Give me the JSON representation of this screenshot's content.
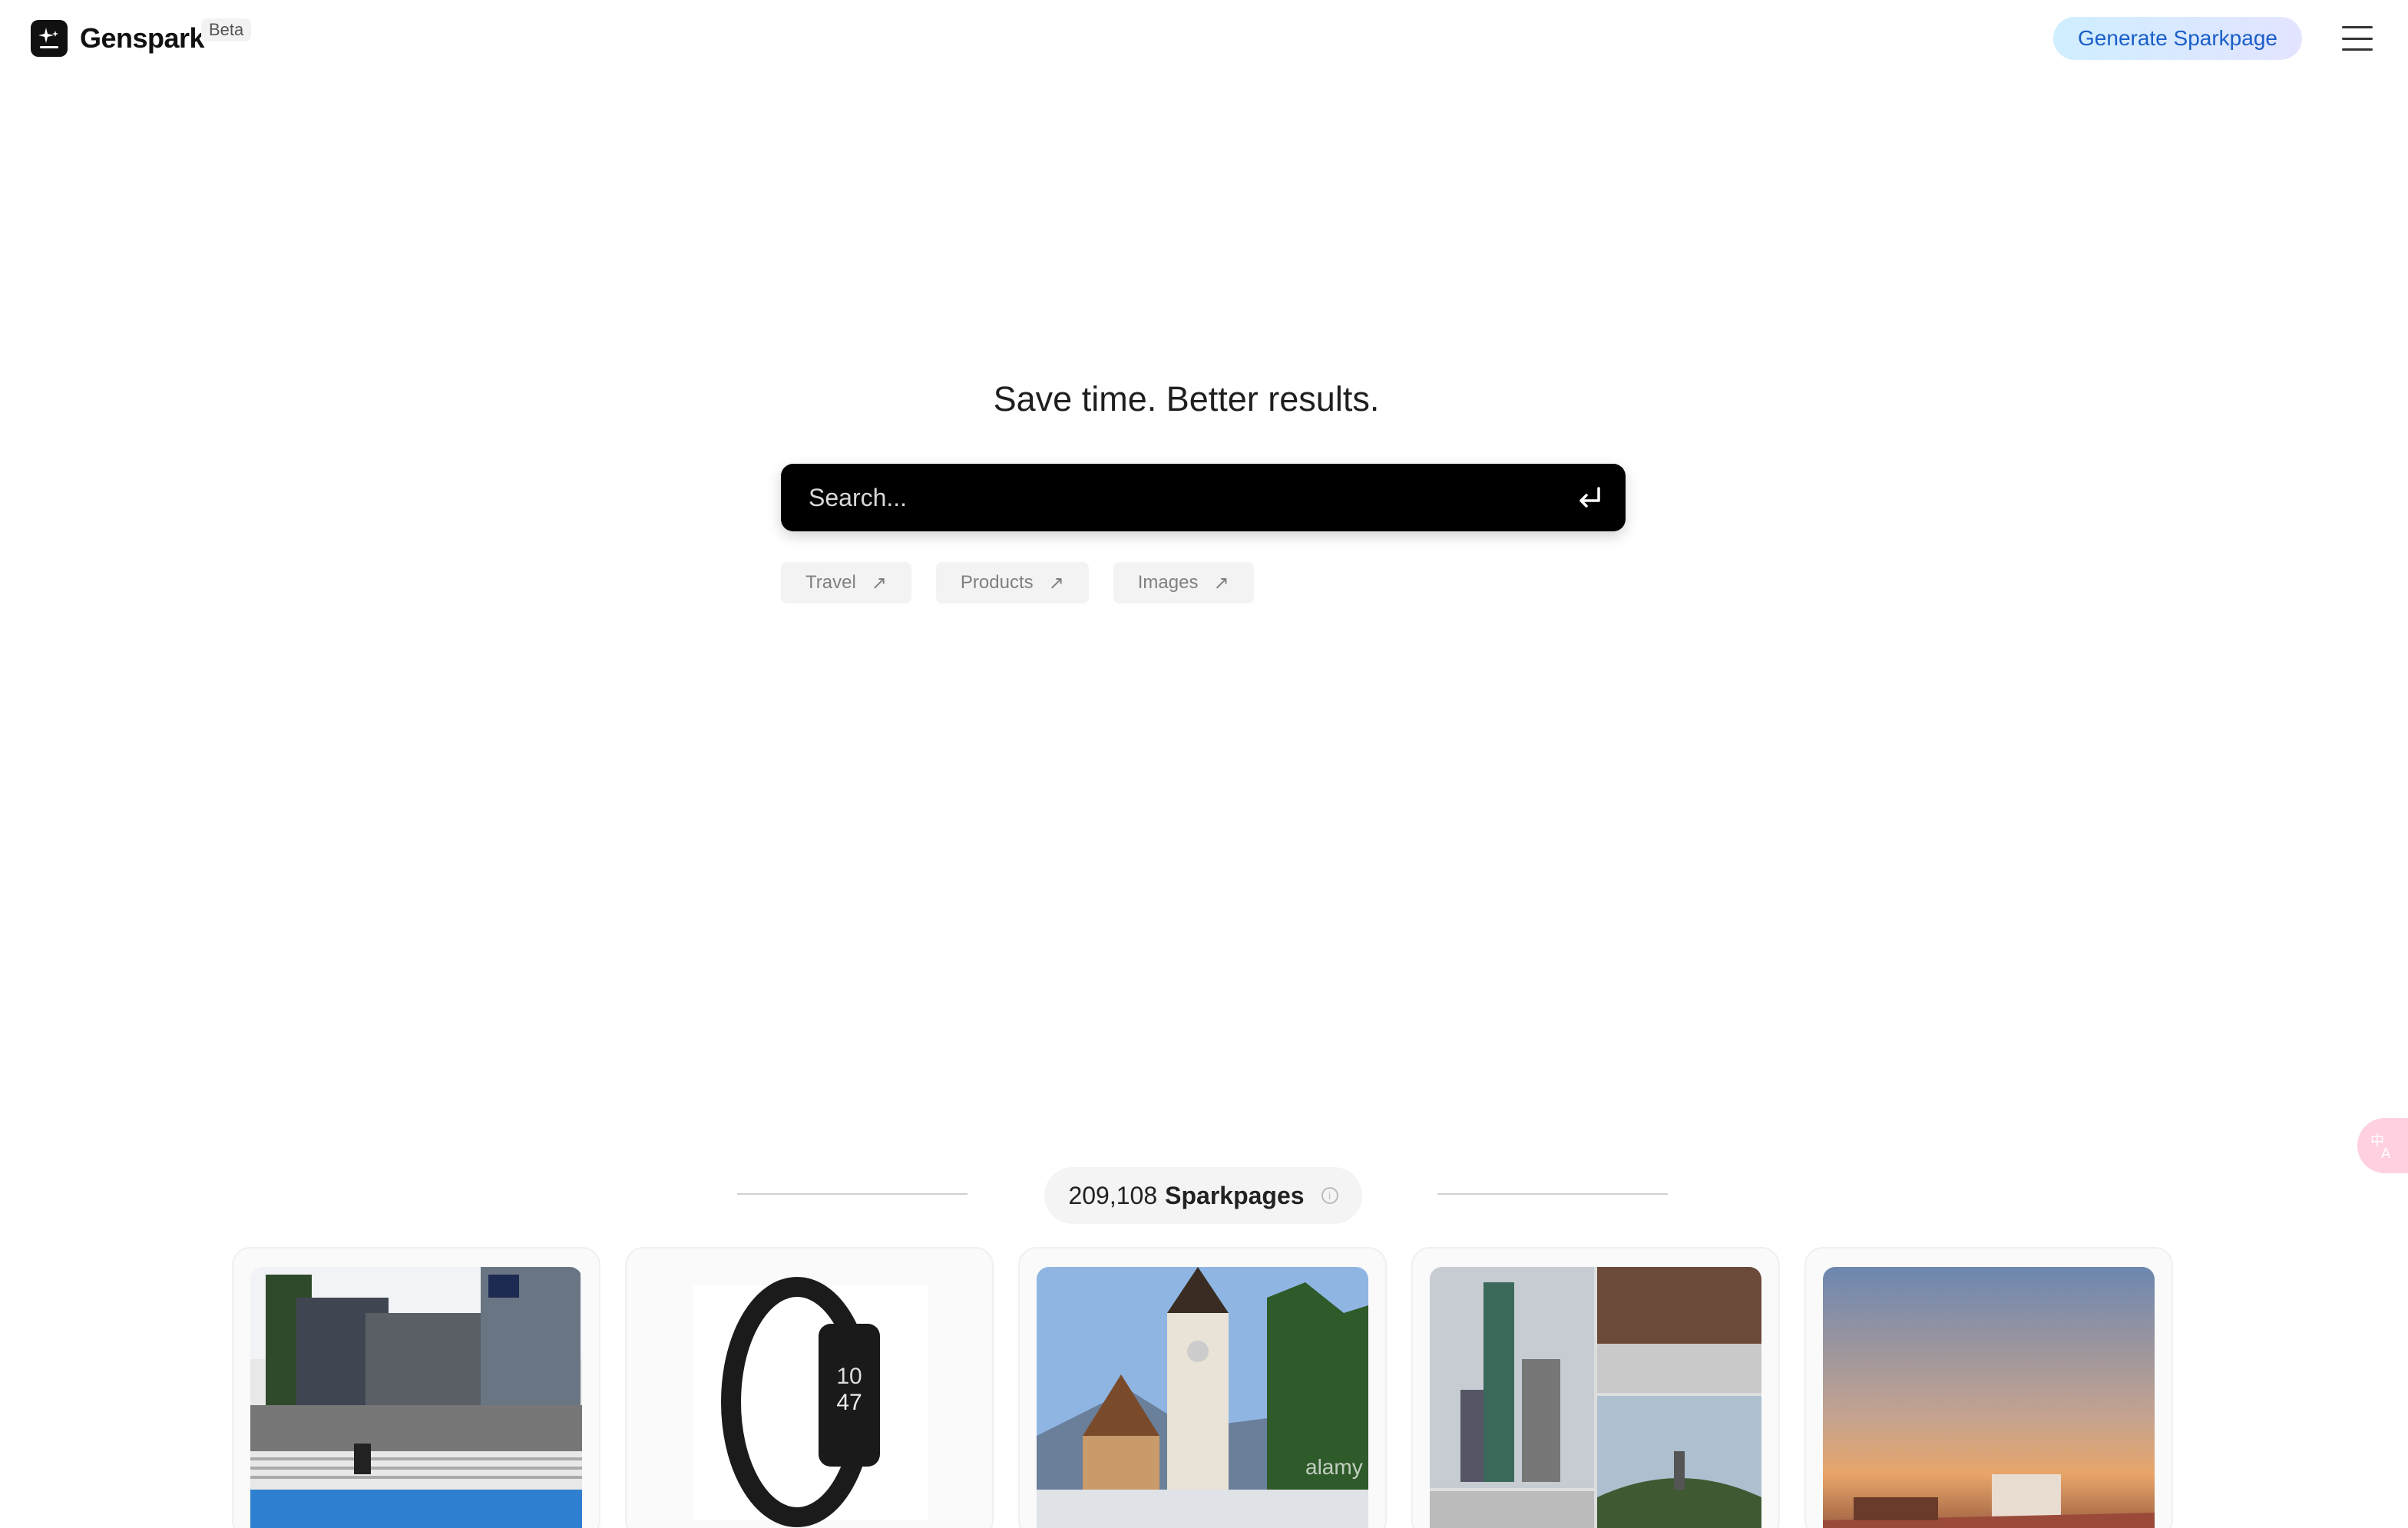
{
  "header": {
    "brand": "Genspark",
    "badge": "Beta",
    "cta_label": "Generate Sparkpage"
  },
  "hero": {
    "tagline": "Save time. Better results.",
    "search_placeholder": "Search...",
    "chips": [
      {
        "label": "Travel",
        "icon": "arrow-up-right-icon"
      },
      {
        "label": "Products",
        "icon": "arrow-up-right-icon"
      },
      {
        "label": "Images",
        "icon": "arrow-up-right-icon"
      }
    ]
  },
  "counter": {
    "number": "209,108",
    "label": "Sparkpages"
  },
  "cards": [
    {
      "image": "campus-building-photo"
    },
    {
      "image": "fitness-tracker-band-photo",
      "band_time": "10 47"
    },
    {
      "image": "church-tower-photo",
      "watermark": "alamy"
    },
    {
      "image": "city-collage-photo"
    },
    {
      "image": "desert-camp-sunset-photo"
    }
  ],
  "colors": {
    "cta_text": "#1a5ec9",
    "search_bg": "#000000",
    "translate_bg": "#ffd0e0"
  }
}
